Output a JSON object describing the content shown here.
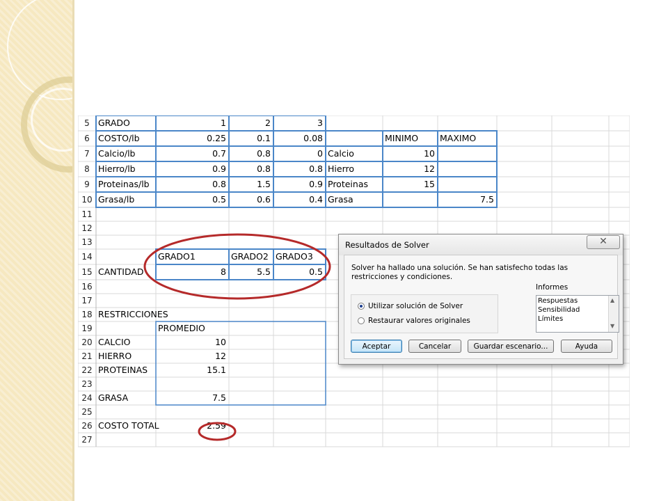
{
  "sheet": {
    "rows": [
      {
        "num": "5",
        "cells": {
          "a": "GRADO",
          "b": "1",
          "c": "2",
          "d": "3"
        }
      },
      {
        "num": "6",
        "cells": {
          "a": "COSTO/lb",
          "b": "0.25",
          "c": "0.1",
          "d": "0.08",
          "f": "MINIMO",
          "g": "MAXIMO"
        }
      },
      {
        "num": "7",
        "cells": {
          "a": "Calcio/lb",
          "b": "0.7",
          "c": "0.8",
          "d": "0",
          "e": "Calcio",
          "f": "10"
        }
      },
      {
        "num": "8",
        "cells": {
          "a": "Hierro/lb",
          "b": "0.9",
          "c": "0.8",
          "d": "0.8",
          "e": "Hierro",
          "f": "12"
        }
      },
      {
        "num": "9",
        "cells": {
          "a": "Proteinas/lb",
          "b": "0.8",
          "c": "1.5",
          "d": "0.9",
          "e": "Proteinas",
          "f": "15"
        }
      },
      {
        "num": "10",
        "cells": {
          "a": "Grasa/lb",
          "b": "0.5",
          "c": "0.6",
          "d": "0.4",
          "e": "Grasa",
          "g": "7.5"
        }
      },
      {
        "num": "11",
        "cells": {}
      },
      {
        "num": "12",
        "cells": {}
      },
      {
        "num": "13",
        "cells": {}
      },
      {
        "num": "14",
        "cells": {
          "b": "GRADO1",
          "c": "GRADO2",
          "d": "GRADO3"
        }
      },
      {
        "num": "15",
        "cells": {
          "a": "CANTIDAD",
          "b": "8",
          "c": "5.5",
          "d": "0.5"
        }
      },
      {
        "num": "16",
        "cells": {}
      },
      {
        "num": "17",
        "cells": {}
      },
      {
        "num": "18",
        "cells": {
          "a": "RESTRICCIONES"
        }
      },
      {
        "num": "19",
        "cells": {
          "b": "PROMEDIO"
        }
      },
      {
        "num": "20",
        "cells": {
          "a": "CALCIO",
          "b": "10"
        }
      },
      {
        "num": "21",
        "cells": {
          "a": "HIERRO",
          "b": "12"
        }
      },
      {
        "num": "22",
        "cells": {
          "a": "PROTEINAS",
          "b": "15.1"
        }
      },
      {
        "num": "23",
        "cells": {}
      },
      {
        "num": "24",
        "cells": {
          "a": "GRASA",
          "b": "7.5"
        }
      },
      {
        "num": "25",
        "cells": {}
      },
      {
        "num": "26",
        "cells": {
          "a": "COSTO TOTAL",
          "b": "2.59"
        }
      },
      {
        "num": "27",
        "cells": {}
      }
    ]
  },
  "dialog": {
    "title": "Resultados de Solver",
    "close_glyph": "✕",
    "message": "Solver ha hallado una solución. Se han satisfecho todas las restricciones y condiciones.",
    "options": [
      {
        "label": "Utilizar solución de Solver",
        "selected": true
      },
      {
        "label": "Restaurar valores originales",
        "selected": false
      }
    ],
    "reports_label": "Informes",
    "reports": [
      "Respuestas",
      "Sensibilidad",
      "Límites"
    ],
    "buttons": {
      "accept": "Aceptar",
      "cancel": "Cancelar",
      "save_scenario": "Guardar escenario...",
      "help": "Ayuda"
    }
  },
  "colors": {
    "table_border": "#4a86c8",
    "gridline": "#d9d9d9",
    "annotation_red": "#b52a2a",
    "sidebar": "#f6e8c0"
  }
}
